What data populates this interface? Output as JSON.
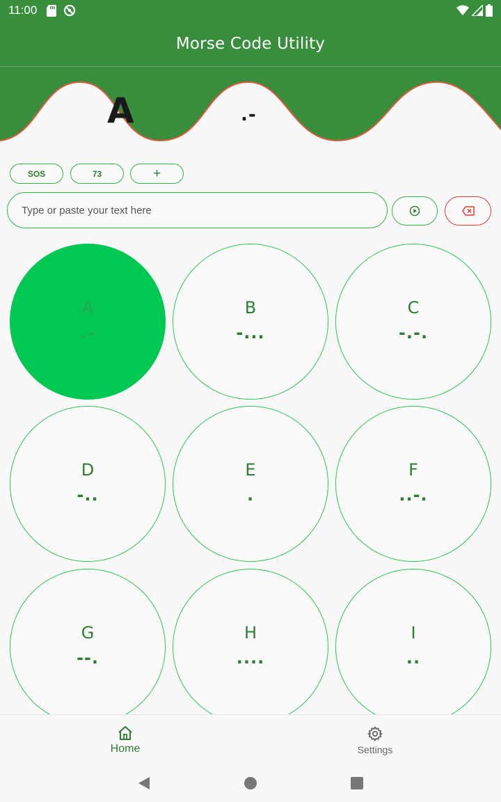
{
  "status_bar": {
    "time": "11:00",
    "left_icons": [
      "sd-card-icon",
      "no-sync-icon"
    ],
    "right_icons": [
      "wifi-icon",
      "signal-icon",
      "battery-icon"
    ]
  },
  "app_bar": {
    "title": "Morse Code Utility"
  },
  "header_display": {
    "letter": "A",
    "code": ".-",
    "wave_color": "#388e3c",
    "wave_edge_color": "#e05a3a"
  },
  "quick_chips": [
    {
      "label": "SOS"
    },
    {
      "label": "73"
    },
    {
      "label": "+"
    }
  ],
  "input": {
    "value": "",
    "placeholder": "Type or paste your text here"
  },
  "actions": {
    "play_icon": "play-circle-icon",
    "clear_icon": "backspace-icon"
  },
  "letters": [
    {
      "letter": "A",
      "code": ".-",
      "active": true
    },
    {
      "letter": "B",
      "code": "-...",
      "active": false
    },
    {
      "letter": "C",
      "code": "-.-.",
      "active": false
    },
    {
      "letter": "D",
      "code": "-..",
      "active": false
    },
    {
      "letter": "E",
      "code": ".",
      "active": false
    },
    {
      "letter": "F",
      "code": "..-.",
      "active": false
    },
    {
      "letter": "G",
      "code": "--.",
      "active": false
    },
    {
      "letter": "H",
      "code": "....",
      "active": false
    },
    {
      "letter": "I",
      "code": "..",
      "active": false
    }
  ],
  "bottom_nav": [
    {
      "label": "Home",
      "icon": "home-icon",
      "selected": true
    },
    {
      "label": "Settings",
      "icon": "gear-icon",
      "selected": false
    }
  ],
  "colors": {
    "primary": "#388e3c",
    "accent_green": "#2fc257",
    "active_cell": "#00c853",
    "danger": "#e53935",
    "text_green": "#2e7d32"
  }
}
